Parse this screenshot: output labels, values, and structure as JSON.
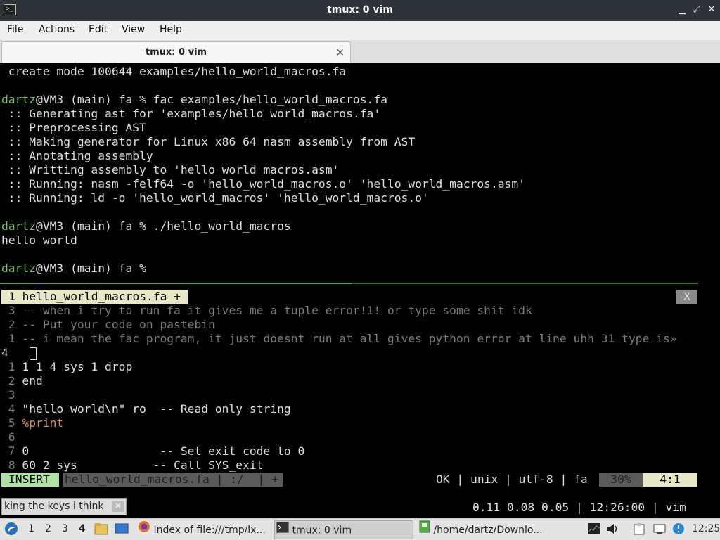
{
  "window": {
    "title": "tmux: 0 vim",
    "app_icon_text": ">_"
  },
  "menu": [
    "File",
    "Actions",
    "Edit",
    "View",
    "Help"
  ],
  "tab": {
    "label": "tmux: 0 vim",
    "close": "×"
  },
  "terminal": {
    "shell": [
      {
        "prompt": "",
        "text": " create mode 100644 examples/hello_world_macros.fa"
      },
      {
        "prompt": "",
        "text": ""
      },
      {
        "prompt": "dartz",
        "text": "@VM3 (main) fa % fac examples/hello_world_macros.fa"
      },
      {
        "prompt": "",
        "text": " :: Generating ast for 'examples/hello_world_macros.fa'"
      },
      {
        "prompt": "",
        "text": " :: Preprocessing AST"
      },
      {
        "prompt": "",
        "text": " :: Making generator for Linux x86_64 nasm assembly from AST"
      },
      {
        "prompt": "",
        "text": " :: Anotating assembly"
      },
      {
        "prompt": "",
        "text": " :: Writting assembly to 'hello_world_macros.asm'"
      },
      {
        "prompt": "",
        "text": " :: Running: nasm -felf64 -o 'hello_world_macros.o' 'hello_world_macros.asm'"
      },
      {
        "prompt": "",
        "text": " :: Running: ld -o 'hello_world_macros' 'hello_world_macros.o'"
      },
      {
        "prompt": "",
        "text": ""
      },
      {
        "prompt": "dartz",
        "text": "@VM3 (main) fa % ./hello_world_macros"
      },
      {
        "prompt": "",
        "text": "hello world"
      },
      {
        "prompt": "",
        "text": ""
      },
      {
        "prompt": "dartz",
        "text": "@VM3 (main) fa %"
      }
    ],
    "vim": {
      "buffer_tab": "1 hello_world_macros.fa +",
      "close_label": "X",
      "lines": [
        {
          "num": " 3",
          "code": " -- when i try to run fa it gives me a tuple error!1! or type some shit idk"
        },
        {
          "num": " 2",
          "code": " -- Put your code on pastebin"
        },
        {
          "num": " 1",
          "code": " -- i mean the fac program, it just doesnt run at all gives python error at line uhh 31 type is»"
        },
        {
          "num": "4 ",
          "code": ""
        },
        {
          "num": " 1",
          "code": " 1 1 4 sys 1 drop"
        },
        {
          "num": " 2",
          "code": " end"
        },
        {
          "num": " 3",
          "code": ""
        },
        {
          "num": " 4",
          "code": " \"hello world\\n\" ro  -- Read only string"
        },
        {
          "num": " 5",
          "code": " %print"
        },
        {
          "num": " 6",
          "code": ""
        },
        {
          "num": " 7",
          "code": " 0                   -- Set exit code to 0"
        },
        {
          "num": " 8",
          "code": " 60 2 sys           -- Call SYS_exit"
        }
      ],
      "status": {
        "mode": "INSERT",
        "file": "hello_world_macros.fa | :/  | +",
        "right": "OK | unix | utf-8 | fa",
        "percent": "30%",
        "position": "4:1"
      },
      "tmux_status": "0.11 0.08 0.05 | 12:26:00 | vim"
    }
  },
  "notification": {
    "text": "king the keys i think",
    "close": "✕"
  },
  "taskbar": {
    "workspaces": [
      "1",
      "2",
      "3",
      "4"
    ],
    "active_workspace": "4",
    "tasks": [
      {
        "label": "Index of file:///tmp/lx..."
      },
      {
        "label": "tmux: 0 vim"
      },
      {
        "label": "/home/dartz/Downlo..."
      }
    ],
    "clock": "12:25"
  },
  "colors": {
    "prompt": "#7dc36f",
    "insert_mode": "#aee3a5",
    "titlebar": "#2d3339"
  }
}
